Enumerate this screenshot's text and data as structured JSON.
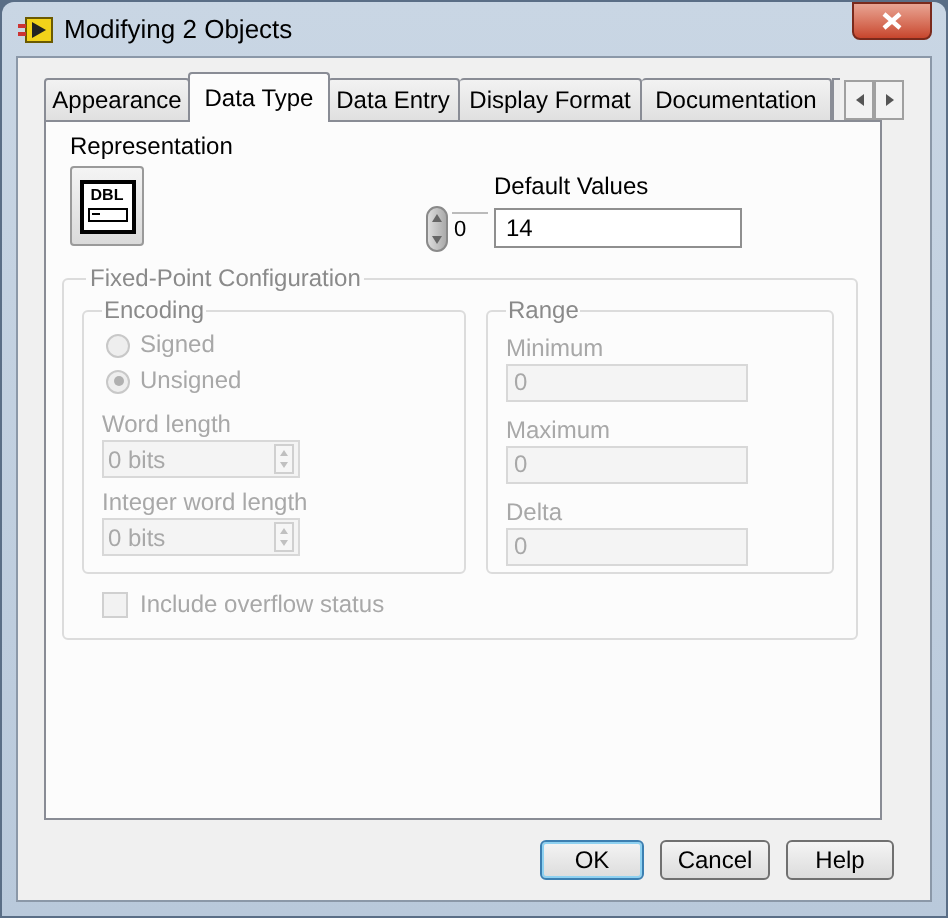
{
  "window": {
    "title": "Modifying 2 Objects"
  },
  "tabs": [
    {
      "label": "Appearance",
      "selected": false
    },
    {
      "label": "Data Type",
      "selected": true
    },
    {
      "label": "Data Entry",
      "selected": false
    },
    {
      "label": "Display Format",
      "selected": false
    },
    {
      "label": "Documentation",
      "selected": false
    }
  ],
  "representation": {
    "label": "Representation",
    "icon_text": "DBL"
  },
  "default_values": {
    "label": "Default Values",
    "index": "0",
    "value": "14"
  },
  "fixed_point": {
    "title": "Fixed-Point Configuration",
    "disabled": true,
    "encoding": {
      "title": "Encoding",
      "options": [
        {
          "label": "Signed",
          "selected": false
        },
        {
          "label": "Unsigned",
          "selected": true
        }
      ],
      "word_length": {
        "label": "Word length",
        "value": "0 bits"
      },
      "integer_word_length": {
        "label": "Integer word length",
        "value": "0 bits"
      }
    },
    "range": {
      "title": "Range",
      "fields": [
        {
          "label": "Minimum",
          "value": "0"
        },
        {
          "label": "Maximum",
          "value": "0"
        },
        {
          "label": "Delta",
          "value": "0"
        }
      ]
    },
    "include_overflow": {
      "label": "Include overflow status",
      "checked": false
    }
  },
  "buttons": [
    {
      "label": "OK",
      "default": true
    },
    {
      "label": "Cancel",
      "default": false
    },
    {
      "label": "Help",
      "default": false
    }
  ]
}
